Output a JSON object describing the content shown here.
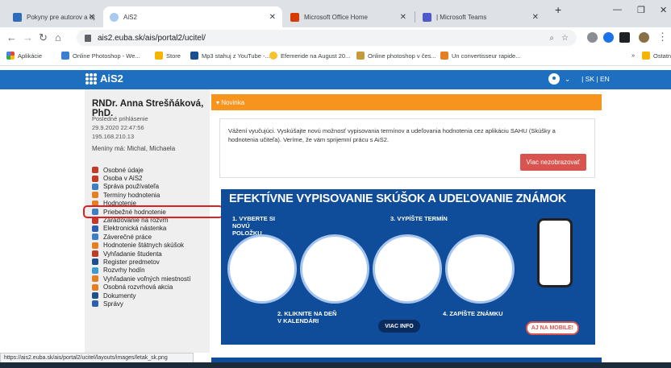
{
  "browser": {
    "tabs": [
      {
        "title": "Pokyny pre autorov a oponentov -",
        "active": false
      },
      {
        "title": "AiS2",
        "active": true
      },
      {
        "title": "Microsoft Office Home",
        "active": false
      },
      {
        "title": "| Microsoft Teams",
        "active": false
      }
    ],
    "url": "ais2.euba.sk/ais/portal2/ucitel/",
    "bookmarks": [
      "Aplikácie",
      "Online Photoshop - We...",
      "Store",
      "Mp3 stahuj z YouTube -...",
      "Efemeride na August 20...",
      "Online photoshop v čes...",
      "Un convertisseur rapide...",
      "»",
      "Ostatné"
    ]
  },
  "app": {
    "name": "AiS2",
    "lang": "| SK | EN"
  },
  "sidebar": {
    "user_name": "RNDr. Anna Strešňáková, PhD.",
    "last_login_label": "Posledné prihlásenie",
    "last_login_date": "29.9.2020 22:47:56",
    "ip": "195.168.210.13",
    "names_label": "Meniny má: Michal, Michaela",
    "menu": [
      {
        "label": "Osobné údaje",
        "icon": "person-icon",
        "color": "#c0392b"
      },
      {
        "label": "Osoba v AiS2",
        "icon": "person-icon",
        "color": "#c0392b"
      },
      {
        "label": "Správa používateľa",
        "icon": "users-icon",
        "color": "#3d7fc1"
      },
      {
        "label": "Termíny hodnotenia",
        "icon": "clock-icon",
        "color": "#e67e22"
      },
      {
        "label": "Hodnotenie",
        "icon": "grade-icon",
        "color": "#e67e22"
      },
      {
        "label": "Priebežné hodnotenie",
        "icon": "list-icon",
        "color": "#3d7fc1"
      },
      {
        "label": "Zaraďovanie na rozvrh",
        "icon": "calendar-icon",
        "color": "#c0392b"
      },
      {
        "label": "Elektronická nástenka",
        "icon": "board-icon",
        "color": "#2e5fae"
      },
      {
        "label": "Záverečné práce",
        "icon": "document-icon",
        "color": "#3d7fc1"
      },
      {
        "label": "Hodnotenie štátnych skúšok",
        "icon": "exam-icon",
        "color": "#e67e22"
      },
      {
        "label": "Vyhľadanie študenta",
        "icon": "student-search-icon",
        "color": "#c0392b"
      },
      {
        "label": "Register predmetov",
        "icon": "register-icon",
        "color": "#1f4e8c"
      },
      {
        "label": "Rozvrhy hodín",
        "icon": "timetable-icon",
        "color": "#3d9bd1"
      },
      {
        "label": "Vyhľadanie voľných miestností",
        "icon": "room-icon",
        "color": "#e67e22"
      },
      {
        "label": "Osobná rozvrhová akcia",
        "icon": "personal-schedule-icon",
        "color": "#e67e22"
      },
      {
        "label": "Dokumenty",
        "icon": "documents-icon",
        "color": "#1f4e8c"
      },
      {
        "label": "Správy",
        "icon": "messages-icon",
        "color": "#2e5fae"
      }
    ],
    "highlighted_item": "Priebežné hodnotenie"
  },
  "main": {
    "novinka_label": "▾ Novinka",
    "notice_text": "Vážení vyučujúci. Vyskúšajte novú možnosť vypisovania termínov a udeľovania hodnotenia cez aplikáciu SAHU (Skúšky a hodnotenia učiteľa). Veríme, že vám sprijemní prácu s AiS2.",
    "hide_button": "Viac nezobrazovať",
    "banner": {
      "title": "EFEKTÍVNE VYPISOVANIE SKÚŠOK A UDEĽOVANIE ZNÁMOK",
      "step1": "1. VYBERTE SI NOVÚ POLOŽKU",
      "step2": "2. KLIKNITE NA DEŇ V KALENDÁRI",
      "step3": "3. VYPÍŠTE TERMÍN",
      "step4": "4. ZAPÍŠTE ZNÁMKU",
      "info_button": "VIAC INFO",
      "mobile_badge": "AJ NA MOBILE!"
    }
  },
  "status_url": "https://ais2.euba.sk/ais/portal2/ucitel/layouts/images/letak_sk.png"
}
